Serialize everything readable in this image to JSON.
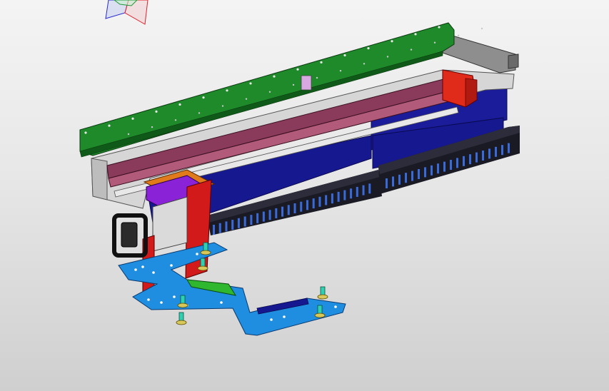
{
  "viewport": {
    "background_top": "#f4f4f4",
    "background_bottom": "#cfcfcf"
  },
  "view_triad": {
    "axis_x_color": "#e0202a",
    "axis_y_color": "#1f9a3a",
    "axis_z_color": "#2a2ad0",
    "icon": "view-orientation-triad-icon"
  },
  "model": {
    "description_icon": "linear-gantry-assembly",
    "part_colors": {
      "top_cover": "#1e8a2a",
      "base_plate": "#d6d6d6",
      "belt_rail": "#8a3a5a",
      "side_beam": "#16188f",
      "cable_chain": "#1a1a24",
      "motor_housing": "#e02a1a",
      "carriage_block": "#8a22d8",
      "carriage_mount": "#e07a1a",
      "gripper_plate": "#1f8ee0",
      "gripper_rib": "#2fb82f",
      "suction_cups": "#d8c85a",
      "fittings": "#2fd0b0"
    }
  }
}
